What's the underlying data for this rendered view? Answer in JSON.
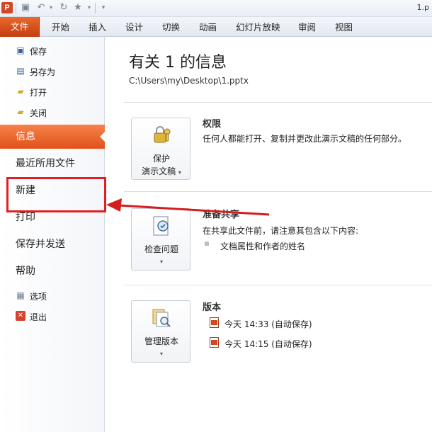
{
  "window": {
    "title": "1.p"
  },
  "ribbon": {
    "tabs": [
      "文件",
      "开始",
      "插入",
      "设计",
      "切换",
      "动画",
      "幻灯片放映",
      "审阅",
      "视图"
    ]
  },
  "backstage": {
    "small_items_top": [
      "保存",
      "另存为",
      "打开",
      "关闭"
    ],
    "big_items": [
      "信息",
      "最近所用文件",
      "新建",
      "打印",
      "保存并发送",
      "帮助"
    ],
    "small_items_bottom": [
      "选项",
      "退出"
    ]
  },
  "info": {
    "title": "有关 1 的信息",
    "path": "C:\\Users\\my\\Desktop\\1.pptx",
    "permissions": {
      "button_line1": "保护",
      "button_line2": "演示文稿",
      "title": "权限",
      "desc": "任何人都能打开、复制并更改此演示文稿的任何部分。"
    },
    "prepare": {
      "button_label": "检查问题",
      "title": "准备共享",
      "desc": "在共享此文件前，请注意其包含以下内容:",
      "bullet": "文档属性和作者的姓名"
    },
    "versions": {
      "button_label": "管理版本",
      "title": "版本",
      "items": [
        "今天 14:33 (自动保存)",
        "今天 14:15 (自动保存)"
      ]
    }
  },
  "colors": {
    "accent": "#e0521a",
    "highlight": "#e02020"
  }
}
